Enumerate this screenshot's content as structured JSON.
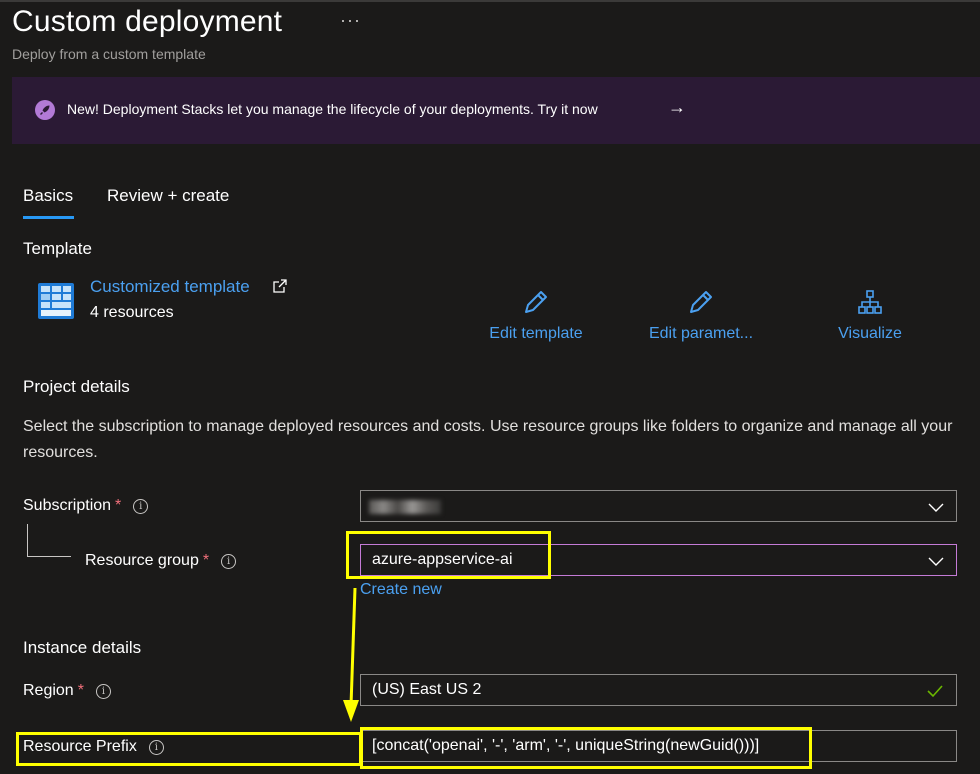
{
  "header": {
    "title": "Custom deployment",
    "more_label": "···",
    "subtitle": "Deploy from a custom template"
  },
  "banner": {
    "text": "New! Deployment Stacks let you manage the lifecycle of your deployments. Try it now",
    "arrow": "→",
    "icon": "rocket-icon"
  },
  "tabs": [
    {
      "label": "Basics",
      "active": true
    },
    {
      "label": "Review + create",
      "active": false
    }
  ],
  "template": {
    "heading": "Template",
    "link_label": "Customized template",
    "resource_count": "4 resources",
    "actions": [
      {
        "label": "Edit template",
        "icon": "pencil-icon"
      },
      {
        "label": "Edit paramet...",
        "icon": "pencil-icon"
      },
      {
        "label": "Visualize",
        "icon": "hierarchy-icon"
      }
    ]
  },
  "project": {
    "heading": "Project details",
    "description": "Select the subscription to manage deployed resources and costs. Use resource groups like folders to organize and manage all your resources.",
    "subscription_label": "Subscription",
    "subscription_value": "",
    "resource_group_label": "Resource group",
    "resource_group_value": "azure-appservice-ai",
    "create_new": "Create new",
    "required_mark": "*",
    "info_mark": "i"
  },
  "instance": {
    "heading": "Instance details",
    "region_label": "Region",
    "region_value": "(US) East US 2",
    "prefix_label": "Resource Prefix",
    "prefix_value": "[concat('openai', '-', 'arm', '-', uniqueString(newGuid()))]"
  },
  "colors": {
    "link": "#4ba0f0",
    "highlight": "#ffff00",
    "required": "#f1707b",
    "valid": "#6bb700"
  }
}
